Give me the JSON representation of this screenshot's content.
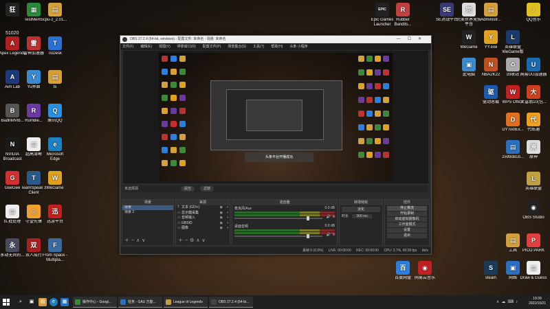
{
  "desktop": {
    "left_icons": [
      {
        "label": "",
        "color": "#222",
        "glyph": "狂"
      },
      {
        "label": "TestMem5",
        "color": "#2a8a3a",
        "glyph": "▦"
      },
      {
        "label": "cpu-z_2.01...",
        "color": "#d4a03a",
        "glyph": "▤"
      },
      {
        "label": "Apex Legends",
        "color": "#b02020",
        "glyph": "A"
      },
      {
        "label": "雷神加速器",
        "color": "#c03030",
        "glyph": "雷"
      },
      {
        "label": "ToDesk",
        "color": "#2a70d0",
        "glyph": "T"
      },
      {
        "label": "Aim Lab",
        "color": "#1e3a7a",
        "glyph": "A"
      },
      {
        "label": "Yu界面",
        "color": "#3a8ad0",
        "glyph": "Y"
      },
      {
        "label": "ts",
        "color": "#d4a03a",
        "glyph": "▤"
      },
      {
        "label": "BadMillVib...",
        "color": "#555",
        "glyph": "B"
      },
      {
        "label": "Rumble...",
        "color": "#6a3aa0",
        "glyph": "R"
      },
      {
        "label": "腾讯QQ",
        "color": "#2a90e0",
        "glyph": "Q"
      },
      {
        "label": "NVIDIA Broadcast",
        "color": "#1a1a1a",
        "glyph": "N"
      },
      {
        "label": "超高清晰",
        "color": "#eee",
        "glyph": "▤"
      },
      {
        "label": "Microsoft Edge",
        "color": "#1a80c0",
        "glyph": "e"
      },
      {
        "label": "GeeGee",
        "color": "#d03030",
        "glyph": "G"
      },
      {
        "label": "TeamSpeak 3 Client",
        "color": "#2a5a8a",
        "glyph": "T"
      },
      {
        "label": "WeGame",
        "color": "#e0a020",
        "glyph": "W"
      },
      {
        "label": "ts.批处理",
        "color": "#eee",
        "glyph": "▤"
      },
      {
        "label": "守望先锋",
        "color": "#f0a030",
        "glyph": "◎"
      },
      {
        "label": "迅游平台",
        "color": "#c02020",
        "glyph": "迅"
      },
      {
        "label": "永劫无间的...",
        "color": "#4a4a5a",
        "glyph": "永"
      },
      {
        "label": "双人成行",
        "color": "#aa2020",
        "glyph": "双"
      },
      {
        "label": "From Space - Multipla...",
        "color": "#3a6aa0",
        "glyph": "F"
      }
    ],
    "right_icons": [
      {
        "label": "Epic Games Launcher",
        "color": "#222",
        "glyph": "EPIC"
      },
      {
        "label": "Rubber Bandits...",
        "color": "#c04040",
        "glyph": "R"
      },
      {
        "label": "SE对战平台",
        "color": "#3a3a7a",
        "glyph": "SE"
      },
      {
        "label": "完美世界竞技平台",
        "color": "#ddd",
        "glyph": "完"
      },
      {
        "label": "Administr...",
        "color": "#d4a03a",
        "glyph": "▤"
      },
      {
        "label": "QQ音乐",
        "color": "#e0c020",
        "glyph": "♪"
      },
      {
        "label": "WeGame",
        "color": "#222",
        "glyph": "W"
      },
      {
        "label": "YY.exe",
        "color": "#e0a020",
        "glyph": "Y"
      },
      {
        "label": "英雄联盟WeGame版",
        "color": "#1a3a6a",
        "glyph": "L"
      },
      {
        "label": "此电脑",
        "color": "#3a8ad0",
        "glyph": "▣"
      },
      {
        "label": "NBA2K22",
        "color": "#c05020",
        "glyph": "N"
      },
      {
        "label": "回收站",
        "color": "#aaa",
        "glyph": "♻"
      },
      {
        "label": "网易UU加速器",
        "color": "#1a6ab0",
        "glyph": "U"
      },
      {
        "label": "驱动总裁",
        "color": "#1a5ab0",
        "glyph": "驱"
      },
      {
        "label": "WPS Office",
        "color": "#c02020",
        "glyph": "W"
      },
      {
        "label": "大富翁10(包...",
        "color": "#d04020",
        "glyph": "大"
      },
      {
        "label": "DYToolEx...",
        "color": "#e07020",
        "glyph": "D"
      },
      {
        "label": "代练通",
        "color": "#f0a020",
        "glyph": "代"
      },
      {
        "label": "2599d81b...",
        "color": "#2a70c0",
        "glyph": "▤"
      },
      {
        "label": "原神",
        "color": "#ddd",
        "glyph": "原"
      },
      {
        "label": "英雄联盟",
        "color": "#c0a040",
        "glyph": "L"
      },
      {
        "label": "OBS Studio",
        "color": "#222",
        "glyph": "◉"
      },
      {
        "label": "工具",
        "color": "#d4a03a",
        "glyph": "▤"
      },
      {
        "label": "PICO PARK",
        "color": "#e04040",
        "glyph": "P"
      },
      {
        "label": "百度网盘",
        "color": "#2a80e0",
        "glyph": "百"
      },
      {
        "label": "网易云音乐",
        "color": "#c02020",
        "glyph": "◉"
      },
      {
        "label": "steam",
        "color": "#1a3a5a",
        "glyph": "S"
      },
      {
        "label": "网络",
        "color": "#2a70c0",
        "glyph": "▣"
      },
      {
        "label": "Draw & Guess",
        "color": "#eee",
        "glyph": "▤"
      }
    ]
  },
  "obs": {
    "title": "OBS 27.2.4 (64-bit, windows) - 配置文件: 未命名 - 场景: 未命名",
    "menu": [
      "文件(F)",
      "编辑(E)",
      "视图(V)",
      "停靠窗口(D)",
      "配置文件(P)",
      "场景集合(S)",
      "工具(T)",
      "帮助(H)",
      "头条 小程序"
    ],
    "preview_notice": "头条平台开播成功",
    "scenebar": {
      "title": "未选择源",
      "props_label": "属性",
      "filter_label": "滤镜"
    },
    "scenes": {
      "header": "场景",
      "items": [
        "场景",
        "场景 2"
      ]
    },
    "sources": {
      "header": "来源",
      "items": [
        {
          "icon": "T",
          "name": "文本 (GDI+)"
        },
        {
          "icon": "▭",
          "name": "显示器采集"
        },
        {
          "icon": "▭",
          "name": "音频输入"
        },
        {
          "icon": "▭",
          "name": "GBSID"
        },
        {
          "icon": "▭",
          "name": "图像"
        }
      ]
    },
    "mixer": {
      "header": "混音器",
      "tracks": [
        {
          "name": "麦克风/Aux",
          "db": "0.0 dB",
          "level": 0.82
        },
        {
          "name": "桌面音频",
          "db": "0.0 dB",
          "level": 0.82
        }
      ]
    },
    "transitions": {
      "header": "转场特效",
      "type": "淡化",
      "duration_label": "时长",
      "duration": "300 ms"
    },
    "controls": {
      "header": "控件",
      "buttons": [
        "停止推流",
        "开始录制",
        "启动虚拟摄像机",
        "工作室模式",
        "设置",
        "退出"
      ]
    },
    "status": {
      "dropped": "丢帧 0 (0.0%)",
      "live": "LIVE: 00:00:00",
      "rec": "REC: 00:00:00",
      "cpu": "CPU: 3.7%, 60.00 fps",
      "kbps": "kb/s"
    }
  },
  "taskbar": {
    "apps": [
      {
        "label": "操作中心 - Googl...",
        "color": "#3a8a3a"
      },
      {
        "label": "任务 - GAU 万能...",
        "color": "#2a70c0"
      },
      {
        "label": "League of Legends",
        "color": "#c0a040"
      },
      {
        "label": "OBS 27.2.4 (64-bi...",
        "color": "#444"
      }
    ],
    "time": "19:39",
    "date": "2022/10/21"
  }
}
